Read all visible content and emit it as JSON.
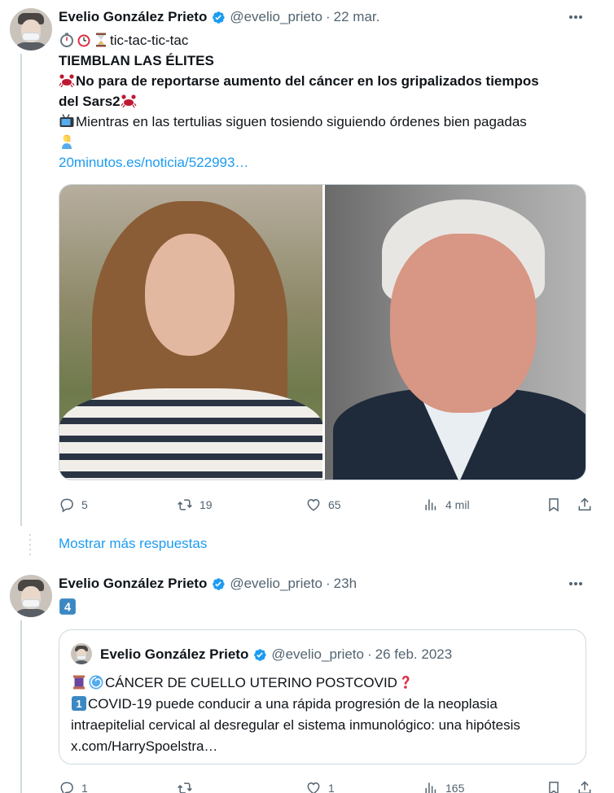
{
  "tweets": [
    {
      "author_name": "Evelio González Prieto",
      "handle": "@evelio_prieto",
      "separator": "·",
      "date": "22 mar.",
      "lines": [
        {
          "emoji": [
            "stopwatch-emoji",
            "alarm-clock-emoji",
            "hourglass-emoji"
          ],
          "text": "tic-tac-tic-tac"
        },
        {
          "text": "TIEMBLAN LAS ÉLITES"
        },
        {
          "emoji": [
            "crab-emoji"
          ],
          "text": "No para de reportarse aumento del cáncer en los gripalizados tiempos"
        },
        {
          "text": "del Sars2"
        },
        {
          "emoji": [
            "television-emoji"
          ],
          "text": "Mientras en las tertulias siguen tosiendo siguiendo órdenes bien pagadas"
        }
      ],
      "link": "20minutos.es/noticia/522993…",
      "actions": {
        "replies": "5",
        "retweets": "19",
        "likes": "65",
        "views": "4 mil"
      }
    },
    {
      "author_name": "Evelio González Prieto",
      "handle": "@evelio_prieto",
      "separator": "·",
      "date": "23h",
      "number_emoji": "4",
      "quote": {
        "author_name": "Evelio González Prieto",
        "handle": "@evelio_prieto",
        "separator": "·",
        "date": "26 feb. 2023",
        "line1": "CÁNCER DE CUELLO UTERINO POSTCOVID",
        "line2_number": "1",
        "line2": "COVID-19 puede conducir a una rápida progresión de la neoplasia",
        "line3": "intraepitelial cervical al desregular el sistema inmunológico: una hipótesis",
        "link": "x.com/HarrySpoelstra…"
      },
      "actions": {
        "replies": "1",
        "retweets": "",
        "likes": "1",
        "views": "165"
      }
    }
  ],
  "show_more": "Mostrar más respuestas",
  "colors": {
    "link": "#1d9bf0",
    "muted": "#536471",
    "verified": "#1d9bf0",
    "border": "#cfd9de"
  }
}
